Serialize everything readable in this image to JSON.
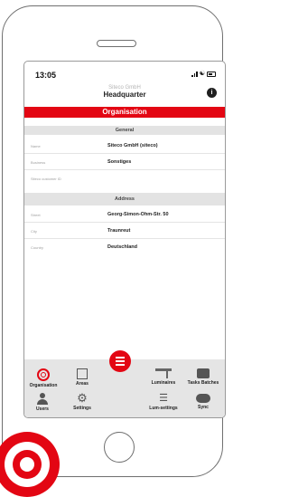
{
  "status": {
    "time": "13:05"
  },
  "header": {
    "company": "Siteco GmbH",
    "location": "Headquarter"
  },
  "page_title": "Organisation",
  "sections": {
    "general": {
      "title": "General",
      "fields": [
        {
          "label": "Name",
          "value": "Siteco GmbH (siteco)"
        },
        {
          "label": "Business",
          "value": "Sonstiges"
        },
        {
          "label": "Siteco customer ID",
          "value": ""
        }
      ]
    },
    "address": {
      "title": "Address",
      "fields": [
        {
          "label": "Street",
          "value": "Georg-Simon-Ohm-Str. 50"
        },
        {
          "label": "City",
          "value": "Traunreut"
        },
        {
          "label": "Country",
          "value": "Deutschland"
        }
      ]
    }
  },
  "nav": {
    "row1": [
      {
        "label": "Organisation",
        "icon": "organisation-icon"
      },
      {
        "label": "Areas",
        "icon": "areas-icon"
      },
      {
        "label": "Luminaires",
        "icon": "luminaire-icon"
      },
      {
        "label": "Tasks Batches",
        "icon": "briefcase-icon"
      }
    ],
    "row2": [
      {
        "label": "Users",
        "icon": "user-icon"
      },
      {
        "label": "Settings",
        "icon": "gear-icon"
      },
      {
        "label": "Lum-settings",
        "icon": "list-settings-icon"
      },
      {
        "label": "Sync",
        "icon": "cloud-sync-icon"
      }
    ]
  },
  "colors": {
    "accent": "#e30613",
    "nav_bg": "#e5e5e5",
    "section_bg": "#e3e3e3"
  }
}
